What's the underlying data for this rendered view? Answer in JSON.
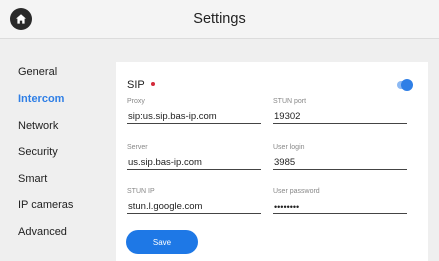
{
  "header": {
    "title": "Settings",
    "home_icon": "home-icon"
  },
  "sidebar": {
    "items": [
      {
        "label": "General"
      },
      {
        "label": "Intercom"
      },
      {
        "label": "Network"
      },
      {
        "label": "Security"
      },
      {
        "label": "Smart"
      },
      {
        "label": "IP cameras"
      },
      {
        "label": "Advanced"
      }
    ],
    "active": "Intercom"
  },
  "panel": {
    "section_title": "SIP",
    "sip_enabled": true,
    "fields": {
      "proxy": {
        "label": "Proxy",
        "value": "sip:us.sip.bas-ip.com"
      },
      "stun_port": {
        "label": "STUN port",
        "value": "19302"
      },
      "server": {
        "label": "Server",
        "value": "us.sip.bas-ip.com"
      },
      "user_login": {
        "label": "User login",
        "value": "3985"
      },
      "stun_ip": {
        "label": "STUN IP",
        "value": "stun.l.google.com"
      },
      "user_password": {
        "label": "User password",
        "value": "••••••••"
      }
    },
    "save_label": "Save"
  },
  "colors": {
    "accent": "#2f7fe6",
    "button": "#1e78e6",
    "status_dot": "#d32a3a",
    "background": "#efefef"
  }
}
